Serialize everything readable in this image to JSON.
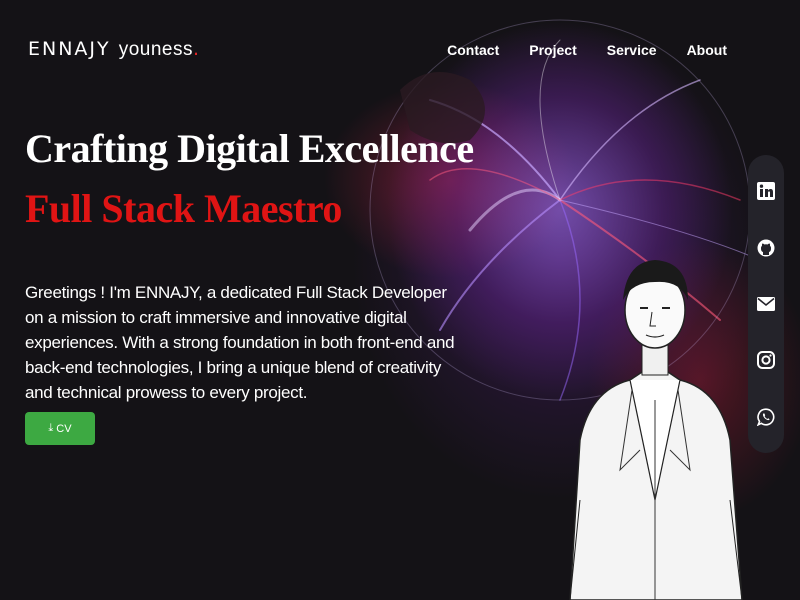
{
  "nav": {
    "logo_first": "ENNAJY",
    "logo_last": "youness",
    "logo_dot": ".",
    "links": [
      "Contact",
      "Project",
      "Service",
      "About"
    ]
  },
  "hero": {
    "headline": "Crafting Digital Excellence",
    "subheadline": "Full Stack Maestro",
    "intro": "Greetings ! I'm ENNAJY, a dedicated Full Stack Developer on a mission to craft immersive and innovative digital experiences. With a strong foundation in both front-end and back-end technologies, I bring a unique blend of creativity and technical prowess to every project.",
    "cv_button": "CV",
    "cv_icon": "download-icon"
  },
  "social": [
    {
      "name": "linkedin-icon"
    },
    {
      "name": "github-icon"
    },
    {
      "name": "mail-icon"
    },
    {
      "name": "instagram-icon"
    },
    {
      "name": "whatsapp-icon"
    }
  ],
  "colors": {
    "accent_red": "#e01414",
    "button_green": "#3da942",
    "background": "#141216",
    "social_bar": "#24232a"
  }
}
